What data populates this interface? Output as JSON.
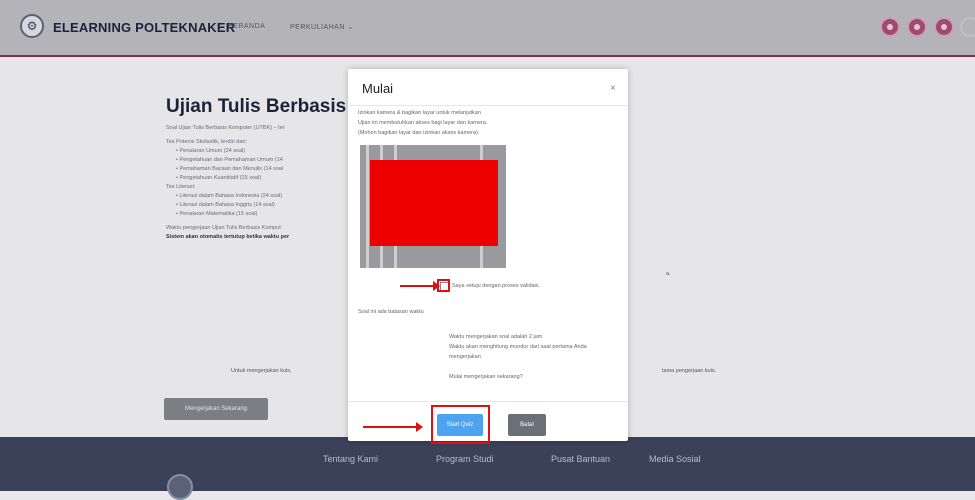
{
  "nav": {
    "brand": "ELEARNING POLTEKNAKER",
    "home": "BERANDA",
    "courses": "PERKULIAHAN ⌄"
  },
  "page": {
    "title": "Ujian Tulis Berbasis Komp",
    "intro": "Soal Ujian Tulis Berbasis Komputer (UTBK) – ter",
    "section1_title": "Tes Potensi Skolastik, terdiri dari:",
    "section1_items": [
      "Penalaran Umum (24 soal)",
      "Pengetahuan dan Pemahaman Umum (14",
      "Pemahaman Bacaan dan Menulis (14 soal",
      "Pengetahuan Kuantitatif (15 soal)"
    ],
    "section2_title": "Tes Literasi:",
    "section2_items": [
      "Literasi dalam Bahasa Indonesia (24 soal)",
      "Literasi dalam Bahasa Inggris (14 soal)",
      "Penalaran Matematika (15 soal)"
    ],
    "time_note": "Waktu pengerjaan Ujian Tulis Berbasis Komput",
    "auto_close_note": "Sistem akan otomatis tertutup ketika waktu per",
    "mid_right": "a.",
    "bottom_left": "Untuk mengerjakan kuis,",
    "bottom_right": "tama pengerjaan kuis.",
    "do_quiz_button": "Mengerjakan Sekarang"
  },
  "footer": {
    "about": "Tentang Kami",
    "program": "Program Studi",
    "help": "Pusat Bantuan",
    "social": "Media Sosial"
  },
  "modal": {
    "title": "Mulai",
    "close": "×",
    "line1": "Izinkan kamera & bagikan layar untuk melanjutkan",
    "line2": "Ujian ini membutuhkan akses bagi layar dan kamera.",
    "line3": "(Mohon bagikan layar dan izinkan akses kamera).",
    "checkbox_label": "Saya setuju dengan proses validasi.",
    "time_limit": "Soal ini ada batasan waktu",
    "duration": "Waktu mengerjakan soal adalah 2 jam",
    "countdown1": "Waktu akan menghitung mundur dari saat pertama Anda",
    "countdown2": "mengerjakan",
    "confirm": "Mulai mengerjakan sekarang?",
    "start_button": "Start Quiz",
    "cancel_button": "Batal"
  },
  "colors": {
    "accent": "#8a2b4a",
    "start_button": "#4ea3f1",
    "annotation": "#dd1111",
    "camera_block": "#ee0000"
  }
}
